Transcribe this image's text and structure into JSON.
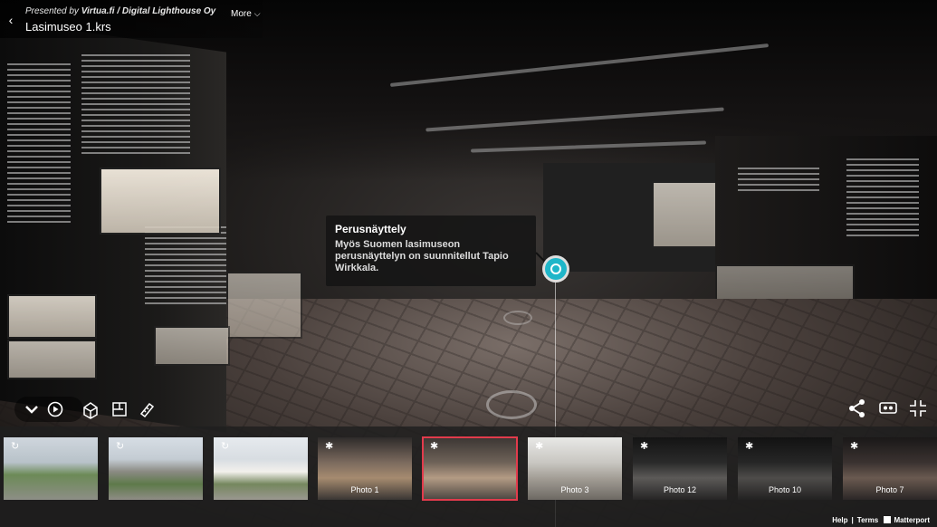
{
  "header": {
    "presented_by_prefix": "Presented by",
    "presented_by_brand": "Virtua.fi / Digital Lighthouse Oy",
    "title": "Lasimuseo 1.krs",
    "more_label": "More"
  },
  "mattertag": {
    "title": "Perusnäyttely",
    "body": "Myös Suomen lasimuseon perusnäyttelyn on suunnitellut Tapio Wirkkala.",
    "accent_color": "#1fb6c9"
  },
  "controls": {
    "left": [
      "chevron-down-icon",
      "play-icon",
      "dollhouse-icon",
      "floorplan-icon",
      "measure-icon"
    ],
    "right": [
      "share-icon",
      "vr-icon",
      "fullscreen-icon"
    ]
  },
  "highlights": [
    {
      "label": "",
      "icon": "360-icon",
      "active": false
    },
    {
      "label": "",
      "icon": "360-icon",
      "active": false
    },
    {
      "label": "",
      "icon": "360-icon",
      "active": false
    },
    {
      "label": "Photo 1",
      "icon": "walk-icon",
      "active": false
    },
    {
      "label": "",
      "icon": "walk-icon",
      "active": true,
      "accent_color": "#e23b4c"
    },
    {
      "label": "Photo 3",
      "icon": "walk-icon",
      "active": false
    },
    {
      "label": "Photo 12",
      "icon": "walk-icon",
      "active": false
    },
    {
      "label": "Photo 10",
      "icon": "walk-icon",
      "active": false
    },
    {
      "label": "Photo 7",
      "icon": "walk-icon",
      "active": false
    }
  ],
  "footer": {
    "help": "Help",
    "separator": "|",
    "terms": "Terms",
    "brand": "Matterport"
  }
}
